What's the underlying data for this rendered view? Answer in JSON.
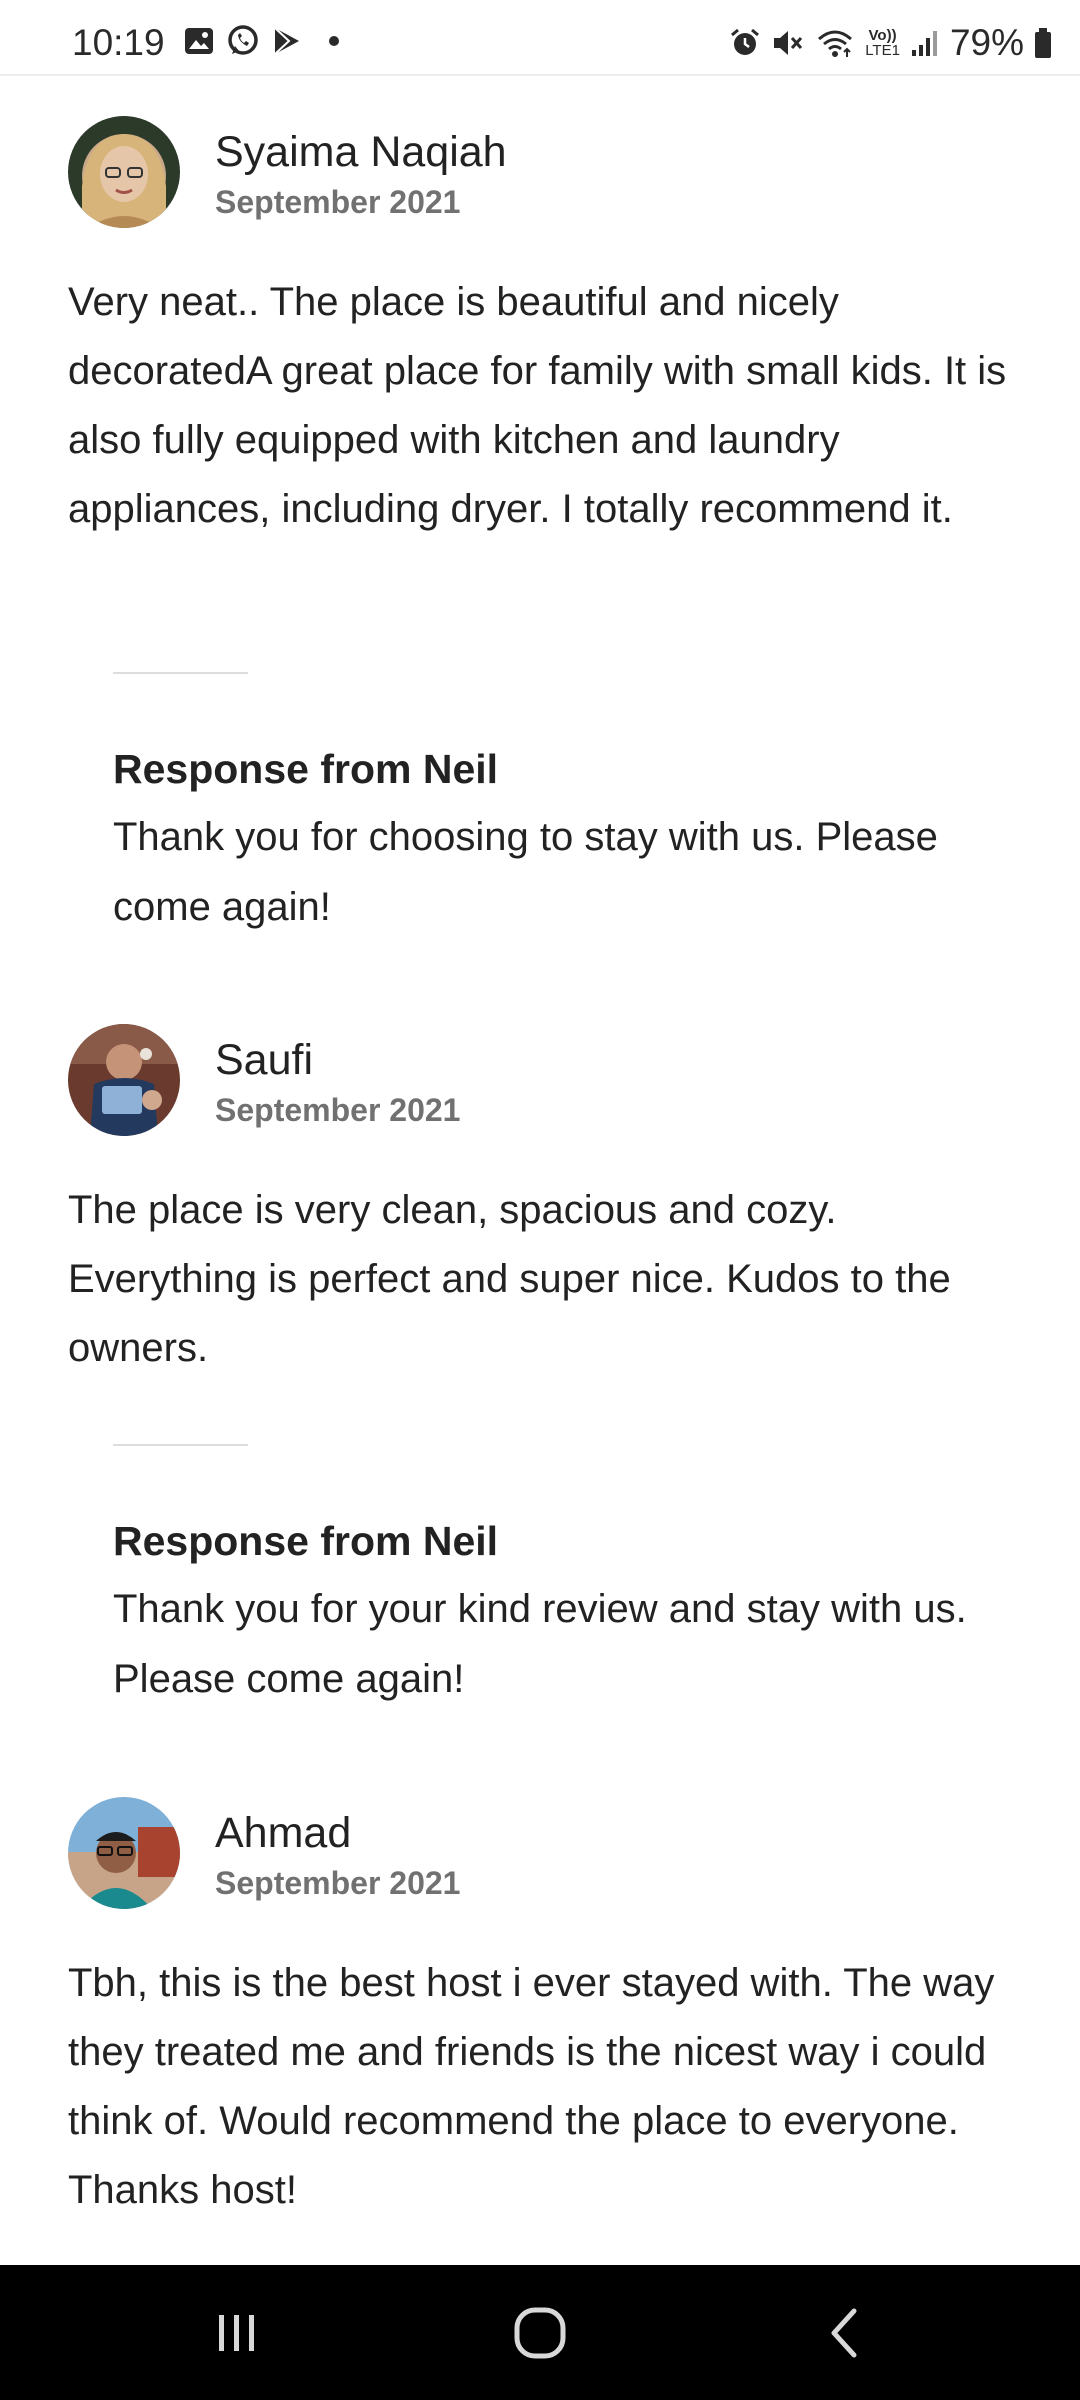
{
  "status_bar": {
    "time": "10:19",
    "left_icons": [
      "gallery-icon",
      "whatsapp-icon",
      "play-store-icon",
      "dot-icon"
    ],
    "right_icons": [
      "alarm-icon",
      "mute-icon",
      "wifi-icon",
      "volte-icon",
      "signal-icon",
      "battery-icon"
    ],
    "network_label_top": "Vo))",
    "network_label_bottom": "LTE1",
    "battery_percent": "79%"
  },
  "reviews": [
    {
      "name": "Syaima Naqiah",
      "date": "September 2021",
      "text": "Very neat.. The place is beautiful and nicely decoratedA great place for family with small kids. It is also fully equipped with kitchen and laundry appliances, including dryer. I totally recommend it.",
      "response_title": "Response from Neil",
      "response_text": "Thank you for choosing to stay with us. Please come again!"
    },
    {
      "name": "Saufi",
      "date": "September 2021",
      "text": "The place is very clean, spacious and cozy. Everything is perfect and super nice. Kudos to the owners.",
      "response_title": "Response from Neil",
      "response_text": "Thank you for your kind review and stay with us. Please come again!"
    },
    {
      "name": "Ahmad",
      "date": "September 2021",
      "text": "Tbh, this is the best host i ever stayed with. The way they treated me and friends is the nicest way i could think of. Would recommend the place to everyone. Thanks host!"
    }
  ],
  "nav_bar": {
    "buttons": [
      "recent-apps-icon",
      "home-icon",
      "back-icon"
    ]
  },
  "colors": {
    "text_primary": "#222222",
    "text_secondary": "#717171",
    "divider": "#dddddd",
    "nav_background": "#000000"
  }
}
